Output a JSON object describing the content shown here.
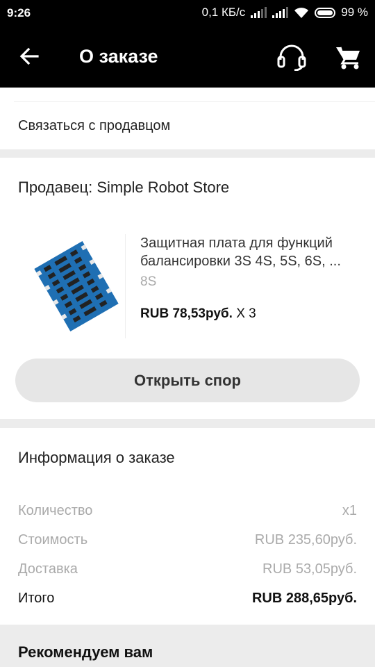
{
  "status": {
    "time": "9:26",
    "network_speed": "0,1 КБ/с",
    "battery": "99 %"
  },
  "toolbar": {
    "title": "О заказе",
    "back_icon": "arrow-left-icon",
    "support_icon": "headset-icon",
    "cart_icon": "cart-icon"
  },
  "contact": {
    "label": "Связаться с продавцом"
  },
  "seller": {
    "label": "Продавец: Simple Robot Store",
    "product": {
      "title": "Защитная плата для функций балансировки 3S 4S, 5S, 6S, ...",
      "variant": "8S",
      "price": "RUB 78,53руб.",
      "quantity": "X 3"
    },
    "dispute_button": "Открыть спор"
  },
  "order_info": {
    "title": "Информация о заказе",
    "rows": [
      {
        "label": "Количество",
        "value": "x1"
      },
      {
        "label": "Стоимость",
        "value": "RUB 235,60руб."
      },
      {
        "label": "Доставка",
        "value": "RUB 53,05руб."
      },
      {
        "label": "Итого",
        "value": "RUB 288,65руб."
      }
    ]
  },
  "recommend": {
    "title": "Рекомендуем вам"
  }
}
